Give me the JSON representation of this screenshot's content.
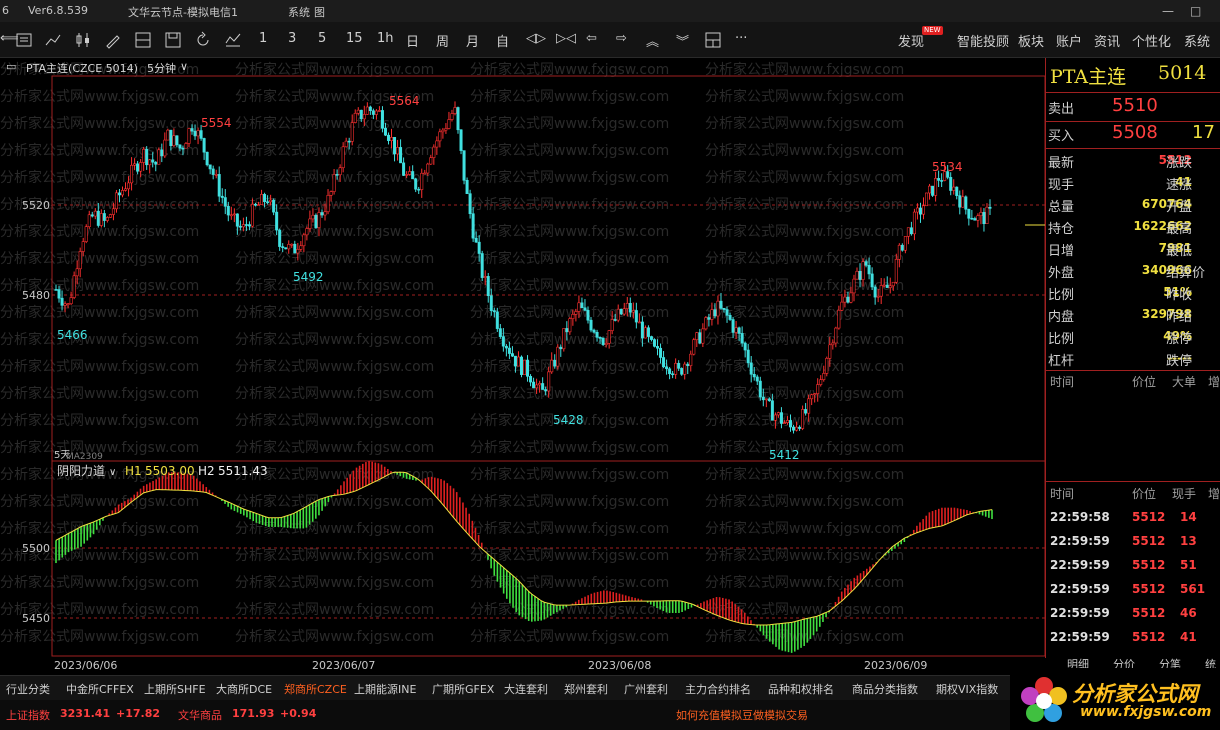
{
  "titlebar": {
    "version": "Ver6.8.539",
    "node": "文华云节点-模拟电信1",
    "menu": "系统",
    "menu2": "图"
  },
  "toolbar": {
    "periods": [
      "1",
      "3",
      "5",
      "15",
      "1h",
      "日",
      "周",
      "月",
      "自"
    ],
    "right_items": [
      "发现",
      "智能投顾",
      "板块",
      "账户",
      "资讯",
      "个性化",
      "系统"
    ],
    "badge": "NEW"
  },
  "chart": {
    "symbol_label": "PTA主连(CZCE 5014)",
    "period_label": "5分钟",
    "indicator_name": "阴阳力道",
    "h1_label": "H1",
    "h1_value": "5503.00",
    "h2_label": "H2",
    "h2_value": "5511.43",
    "ma_label": "MA2309",
    "days_label": "5天",
    "price_ticks": [
      "5520",
      "5480"
    ],
    "ind_ticks": [
      "5500",
      "5450"
    ],
    "dates": [
      "2023/06/06",
      "2023/06/07",
      "2023/06/08",
      "2023/06/09"
    ],
    "annotations": [
      {
        "text": "5554",
        "color": "red"
      },
      {
        "text": "5564",
        "color": "red"
      },
      {
        "text": "5534",
        "color": "red"
      },
      {
        "text": "5466",
        "color": "cyan"
      },
      {
        "text": "5492",
        "color": "cyan"
      },
      {
        "text": "5428",
        "color": "cyan"
      },
      {
        "text": "5412",
        "color": "cyan"
      }
    ],
    "watermark": "分析家公式网www.fxjgsw.com"
  },
  "chart_data": {
    "type": "candlestick",
    "title": "PTA主连(CZCE 5014) 5分钟",
    "ylim": [
      5400,
      5575
    ],
    "x_dates": [
      "2023/06/06",
      "2023/06/07",
      "2023/06/08",
      "2023/06/09"
    ],
    "key_points": [
      {
        "label": "5466",
        "value": 5466
      },
      {
        "label": "5554",
        "value": 5554
      },
      {
        "label": "5492",
        "value": 5492
      },
      {
        "label": "5564",
        "value": 5564
      },
      {
        "label": "5428",
        "value": 5428
      },
      {
        "label": "5412",
        "value": 5412
      },
      {
        "label": "5534",
        "value": 5534
      }
    ],
    "close_path": [
      5478,
      5470,
      5500,
      5512,
      5508,
      5520,
      5530,
      5540,
      5535,
      5548,
      5542,
      5554,
      5540,
      5525,
      5510,
      5505,
      5515,
      5520,
      5500,
      5495,
      5505,
      5510,
      5520,
      5540,
      5555,
      5560,
      5558,
      5545,
      5530,
      5525,
      5540,
      5550,
      5560,
      5520,
      5490,
      5470,
      5455,
      5445,
      5440,
      5430,
      5445,
      5460,
      5470,
      5462,
      5455,
      5465,
      5470,
      5460,
      5450,
      5445,
      5440,
      5450,
      5460,
      5470,
      5465,
      5455,
      5440,
      5425,
      5420,
      5415,
      5420,
      5430,
      5450,
      5470,
      5480,
      5490,
      5475,
      5480,
      5500,
      5510,
      5520,
      5530,
      5525,
      5515,
      5510,
      5512
    ],
    "indicator": {
      "name": "阴阳力道",
      "H1": 5503.0,
      "H2": 5511.43,
      "ylim": [
        5420,
        5540
      ]
    }
  },
  "quote": {
    "title": "PTA主连",
    "code": "5014",
    "sell_label": "卖出",
    "sell_value": "5510",
    "buy_label": "买入",
    "buy_value": "5508",
    "buy_volume": "17",
    "rows": [
      {
        "label": "最新",
        "value": "5512",
        "color": "red",
        "label2": "涨跌"
      },
      {
        "label": "现手",
        "value": "41",
        "color": "yellow",
        "label2": "速涨"
      },
      {
        "label": "总量",
        "value": "670764",
        "color": "yellow",
        "label2": "开盘"
      },
      {
        "label": "持仓",
        "value": "1622662",
        "color": "yellow",
        "label2": "最高"
      },
      {
        "label": "日增",
        "value": "7981",
        "color": "yellow",
        "label2": "最低"
      },
      {
        "label": "外盘",
        "value": "340966",
        "color": "yellow",
        "label2": "结算价"
      },
      {
        "label": "比例",
        "value": "51%",
        "color": "yellow",
        "label2": "昨收"
      },
      {
        "label": "内盘",
        "value": "329798",
        "color": "yellow",
        "label2": "昨结"
      },
      {
        "label": "比例",
        "value": "49%",
        "color": "yellow",
        "label2": "涨停"
      },
      {
        "label": "杠杆",
        "value": "-----",
        "color": "yellow",
        "label2": "跌停"
      }
    ],
    "big_header": [
      "时间",
      "价位",
      "大单",
      "增"
    ],
    "tick_header": [
      "时间",
      "价位",
      "现手",
      "增"
    ],
    "ticks": [
      {
        "time": "22:59:58",
        "price": "5512",
        "vol": "14"
      },
      {
        "time": "22:59:59",
        "price": "5512",
        "vol": "13"
      },
      {
        "time": "22:59:59",
        "price": "5512",
        "vol": "51"
      },
      {
        "time": "22:59:59",
        "price": "5512",
        "vol": "561"
      },
      {
        "time": "22:59:59",
        "price": "5512",
        "vol": "46"
      },
      {
        "time": "22:59:59",
        "price": "5512",
        "vol": "41"
      }
    ],
    "side_tabs": [
      "明细",
      "分价",
      "分笔",
      "统"
    ]
  },
  "bottom_tabs": [
    "行业分类",
    "中金所CFFEX",
    "上期所SHFE",
    "大商所DCE",
    "郑商所CZCE",
    "上期能源INE",
    "广期所GFEX",
    "大连套利",
    "郑州套利",
    "广州套利",
    "主力合约排名",
    "品种和权排名",
    "商品分类指数",
    "期权VIX指数"
  ],
  "status": {
    "index1_name": "上证指数",
    "index1_value": "3231.41",
    "index1_change": "+17.82",
    "index2_name": "文华商品",
    "index2_value": "171.93",
    "index2_change": "+0.94",
    "notice": "如何充值模拟豆做模拟交易"
  },
  "logo": {
    "text": "分析家公式网",
    "url": "www.fxjgsw.com"
  }
}
